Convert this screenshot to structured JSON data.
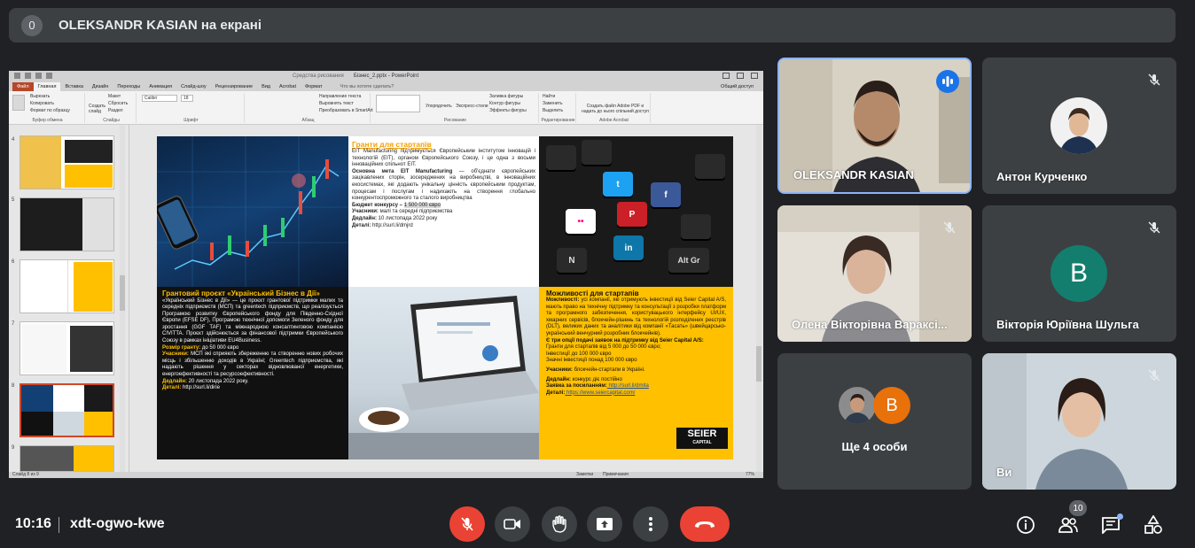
{
  "banner": {
    "count": "0",
    "title": "OLEKSANDR KASIAN на екрані"
  },
  "ppt": {
    "window_title": "Бізнес_2.pptx - PowerPoint",
    "tools_title": "Средства рисования",
    "tabs": [
      "Файл",
      "Главная",
      "Вставка",
      "Дизайн",
      "Переходы",
      "Анимация",
      "Слайд-шоу",
      "Рецензирование",
      "Вид",
      "Acrobat",
      "Формат"
    ],
    "search": "Что вы хотите сделать?",
    "share": "Общий доступ",
    "groups": [
      "Буфер обмена",
      "Слайды",
      "Шрифт",
      "Абзац",
      "Рисование",
      "Редактирование",
      "Adobe Acrobat"
    ],
    "ribbon_labels": {
      "cut": "Вырезать",
      "copy": "Копировать",
      "format_painter": "Формат по образцу",
      "new_slide": "Создать слайд",
      "layout": "Макет",
      "reset": "Сбросить",
      "section": "Раздел",
      "font": "Calibri",
      "size": "18",
      "text_direction": "Направление текста",
      "align_text": "Выровнять текст",
      "smartart": "Преобразовать в SmartArt",
      "arrange": "Упорядочить",
      "quick_styles": "Экспресс-стили",
      "shape_fill": "Заливка фигуры",
      "shape_outline": "Контур фигуры",
      "shape_effects": "Эффекты фигуры",
      "find": "Найти",
      "replace": "Заменить",
      "select": "Выделить",
      "acrobat": "Создать файл Adobe PDF и надать до нього спільний доступ"
    },
    "thumb_numbers": [
      "4",
      "5",
      "6",
      "7",
      "8",
      "9"
    ],
    "status_left": "Слайд 8 из 9",
    "status_notes": "Заметки",
    "status_comments": "Примечания",
    "zoom": "77%"
  },
  "slide": {
    "q2": {
      "title": "Гранти для стартапів",
      "p1": "EIT Manufacturing підтримується Європейським інститутом інновацій і технологій (EIT), органом Європейського Союзу, і це одна з восьми інноваційних спільнот EIT.",
      "p2_bold": "Основна мета EIT Manufacturing",
      "p2": " — об'єднати європейських зацікавлених сторін, зосереджених на виробництві, в інноваційних екосистемах, які додають унікальну цінність європейським продуктам, процесам і послугам і надихають на створення глобально конкурентоспроможного та сталого виробництва",
      "budget_label": "Бюджет конкурсу – ",
      "budget": "1 500 000 євро",
      "participants_label": "Учасники:",
      "participants": " малі та середні підприємства",
      "deadline_label": "Дедлайн:",
      "deadline": " 10 листопада 2022 року",
      "details_label": "Деталі:",
      "details": " http://surl.li/dmjrd"
    },
    "q4": {
      "title": "Грантовий проєкт «Український Бізнес в Дії»",
      "p1": "«Український Бізнес в Дії» — це проєкт грантової підтримки малих та середніх підприємств (МСП) та greentech підприємств, що реалізується Програмою розвитку Європейського фонду для Південно-Східної Європи (EFSE DF), Програмою технічної допомоги Зеленого фонду для зростання (GGF TAF) та міжнародною консалтинговою компанією CIVITTA. Проєкт здійснюється за фінансової підтримки Європейського Союзу в рамках ініціативи EU4Business.",
      "size_label": "Розмір гранту:",
      "size": " до 50 000 євро",
      "participants_label": "Учасники:",
      "participants": " МСП які сприяють збереженню та створенню нових робочих місць і збільшенню доходів в Україні; Greentech підприємства, які надають рішення у секторах відновлюваної енергетики, енергоефективності та ресурсоефективності.",
      "deadline_label": "Дедлайн:",
      "deadline": " 20 листопада 2022 року.",
      "details_label": "Деталі:",
      "details": " http://surl.li/dirie"
    },
    "q6": {
      "title": "Можливості для стартапів",
      "p1_label": "Можливості:",
      "p1": " усі компанії, які отримують інвестиції від Seier Capital A/S, мають право на технічну підтримку та консультації з розробки платформ та програмного забезпечення, користувацького інтерфейсу UI/UX, хмарних сервісів, блокчейн-рішень та технологій розподілених реєстрів (DLT), великих даних та аналітики від компанії «Тасать» (швейцарсько-український венчурний розробник блокчейнів).",
      "p2": "Є три опції подачі заявок на підтримку від Seier Capital A/S:",
      "opt1": "Гранти для стартапів від 5 000 до 50 000 євро;",
      "opt2": "Інвестиції до 100 000 євро",
      "opt3": "Значні інвестиції понад 100 000 євро",
      "participants_label": "Учасники:",
      "participants": " блокчейн-стартапи в Україні.",
      "deadline_label": "Дедлайн:",
      "deadline": " конкурс діє постійно",
      "apply_label": "Заявка за посиланням:",
      "apply": " http://surl.li/dmita",
      "details_label": "Деталі:",
      "details": " https://www.seiercapital.com/",
      "logo": "SEIER",
      "logo_sub": "CAPITAL"
    },
    "keys": [
      "N",
      "Alt Gr"
    ]
  },
  "participants": [
    {
      "name": "OLEKSANDR KASIAN",
      "speaking": true
    },
    {
      "name": "Антон Курченко"
    },
    {
      "name": "Олена Вікторівна Вараксі...",
      "video": true
    },
    {
      "name": "Вікторія Юріївна Шульга",
      "initial": "B",
      "color": "#137e6d"
    },
    {
      "name": "Ще 4 особи",
      "initial": "B",
      "color": "#e8710a"
    },
    {
      "name": "Ви",
      "video": true
    }
  ],
  "bottom": {
    "time": "10:16",
    "meeting_code": "xdt-ogwo-kwe",
    "people_count": "10"
  },
  "colors": {
    "bg": "#202124",
    "tile": "#3c4043",
    "red": "#ea4335",
    "accent": "#8ab4f8"
  }
}
